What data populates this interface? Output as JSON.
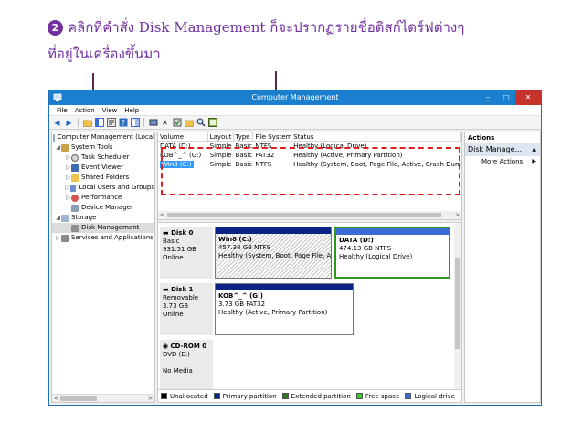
{
  "caption": {
    "step": "2",
    "line1": "คลิกที่คำสั่ง Disk Management  ก็จะปรากฏรายชื่อดิสก์ไดร์ฟต่างๆ",
    "line2": "ที่อยู่ในเครื่องขึ้นมา"
  },
  "window": {
    "title": "Computer Management",
    "minimize": "–",
    "maximize": "□",
    "close": "✕"
  },
  "menu": [
    "File",
    "Action",
    "View",
    "Help"
  ],
  "toolbar": {
    "back": "◀",
    "forward": "▶",
    "delete": "✕"
  },
  "tree": {
    "root": "Computer Management (Local",
    "system_tools": "System Tools",
    "task_scheduler": "Task Scheduler",
    "event_viewer": "Event Viewer",
    "shared_folders": "Shared Folders",
    "local_users": "Local Users and Groups",
    "performance": "Performance",
    "device_manager": "Device Manager",
    "storage": "Storage",
    "disk_management": "Disk Management",
    "services": "Services and Applications",
    "scroll_left": "<",
    "scroll_right": ">"
  },
  "volume_list": {
    "headers": [
      "Volume",
      "Layout",
      "Type",
      "File System",
      "Status"
    ],
    "rows": [
      [
        "DATA (D:)",
        "Simple",
        "Basic",
        "NTFS",
        "Healthy (Logical Drive)"
      ],
      [
        "KOB^_^ (G:)",
        "Simple",
        "Basic",
        "FAT32",
        "Healthy (Active, Primary Partition)"
      ],
      [
        "Win8 (C:)",
        "Simple",
        "Basic",
        "NTFS",
        "Healthy (System, Boot, Page File, Active, Crash Dump, Pr"
      ]
    ],
    "scroll_left": "<",
    "scroll_right": ">"
  },
  "disks": [
    {
      "name": "Disk 0",
      "type": "Basic",
      "size": "931.51 GB",
      "state": "Online",
      "partitions": [
        {
          "label": "Win8 (C:)",
          "size": "457.38 GB NTFS",
          "status": "Healthy (System, Boot, Page File, Acti"
        },
        {
          "label": "DATA (D:)",
          "size": "474.13 GB NTFS",
          "status": "Healthy (Logical Drive)"
        }
      ]
    },
    {
      "name": "Disk 1",
      "type": "Removable",
      "size": "3.73 GB",
      "state": "Online",
      "partitions": [
        {
          "label": "KOB^_^ (G:)",
          "size": "3.73 GB FAT32",
          "status": "Healthy (Active, Primary Partition)"
        }
      ]
    },
    {
      "name": "CD-ROM 0",
      "type": "DVD (E:)",
      "size": "",
      "state": "No Media",
      "partitions": []
    }
  ],
  "legend": [
    {
      "label": "Unallocated",
      "color": "#000000"
    },
    {
      "label": "Primary partition",
      "color": "#0a2485"
    },
    {
      "label": "Extended partition",
      "color": "#2c7a1a"
    },
    {
      "label": "Free space",
      "color": "#33cc33"
    },
    {
      "label": "Logical drive",
      "color": "#3a6bd6"
    }
  ],
  "actions": {
    "header": "Actions",
    "section": "Disk Manage...",
    "more": "More Actions",
    "section_arrow": "▲",
    "more_arrow": "▶"
  },
  "colors": {
    "caption": "#7030a0",
    "titlebar": "#1b7fd0",
    "highlight_box": "#e21c1c",
    "primary_partition": "#0a2485",
    "selection": "#3399ff"
  }
}
